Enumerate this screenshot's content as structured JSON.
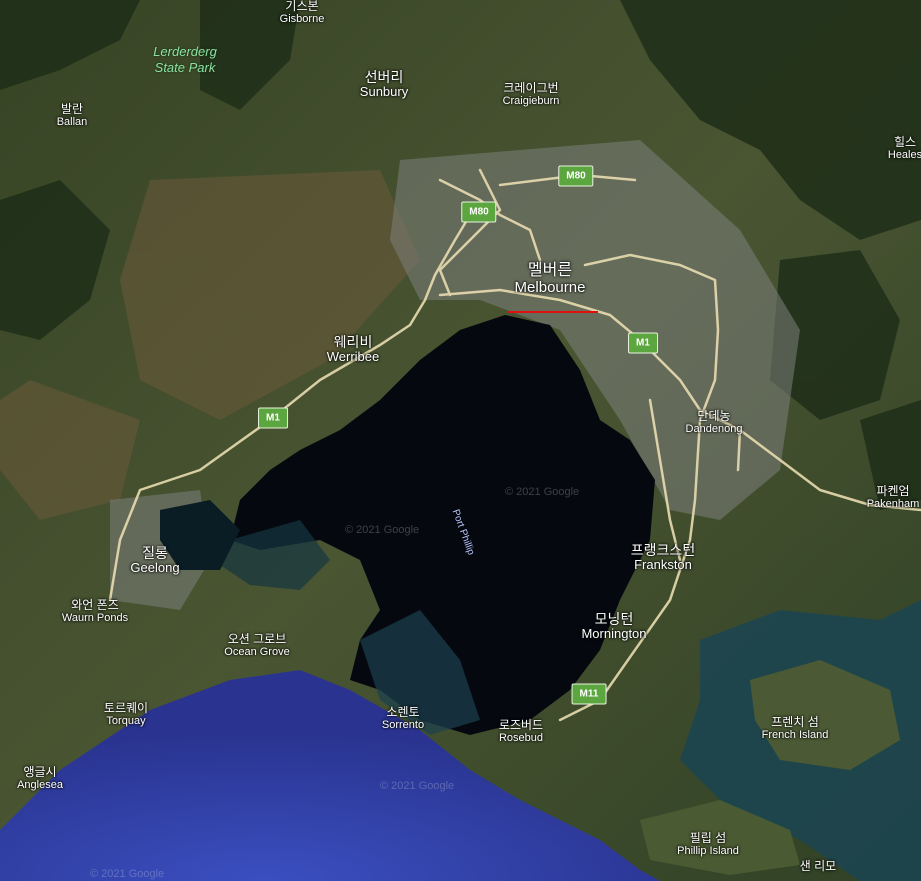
{
  "places": {
    "gisborne": {
      "ko": "기스본",
      "en": "Gisborne"
    },
    "sunbury": {
      "ko": "선버리",
      "en": "Sunbury"
    },
    "craigieburn": {
      "ko": "크레이그번",
      "en": "Craigieburn"
    },
    "bacchus": {
      "ko": "발란",
      "en": "Ballan"
    },
    "healesville": {
      "ko": "힐스",
      "en": "Heales"
    },
    "melbourne": {
      "ko": "멜버른",
      "en": "Melbourne"
    },
    "werribee": {
      "ko": "웨리비",
      "en": "Werribee"
    },
    "dandenong": {
      "ko": "단데농",
      "en": "Dandenong"
    },
    "pakenham": {
      "ko": "파켄엄",
      "en": "Pakenham"
    },
    "geelong": {
      "ko": "질롱",
      "en": "Geelong"
    },
    "frankston": {
      "ko": "프랭크스턴",
      "en": "Frankston"
    },
    "waurn": {
      "ko": "와언 폰즈",
      "en": "Waurn Ponds"
    },
    "mornington": {
      "ko": "모닝턴",
      "en": "Mornington"
    },
    "oceangrove": {
      "ko": "오션 그로브",
      "en": "Ocean Grove"
    },
    "torquay": {
      "ko": "토르퀘이",
      "en": "Torquay"
    },
    "sorrento": {
      "ko": "소렌토",
      "en": "Sorrento"
    },
    "rosebud": {
      "ko": "로즈버드",
      "en": "Rosebud"
    },
    "frenchisland": {
      "ko": "프렌치 섬",
      "en": "French Island"
    },
    "anglesea": {
      "ko": "앵글시",
      "en": "Anglesea"
    },
    "phillipisland": {
      "ko": "필립 섬",
      "en": "Phillip Island"
    },
    "sanremo": {
      "ko": "샌 리모",
      "en": ""
    }
  },
  "park": {
    "line1": "Lerderderg",
    "line2": "State Park"
  },
  "water": {
    "port_phillip": "Port Phillip"
  },
  "shields": {
    "m80a": "M80",
    "m80b": "M80",
    "m1a": "M1",
    "m1b": "M1",
    "m11": "M11"
  },
  "copyright": {
    "a": "© 2021 Google",
    "b": "© 2021 Google",
    "c": "© 2021 Google",
    "d": "© 2021 Google"
  },
  "colors": {
    "land": "#3e4a2a",
    "bay": "#05090f",
    "ocean": "#2d3ea0",
    "road": "#e8dcb0",
    "highway_shield": "#5ba63f",
    "highlight_line": "#e01010"
  }
}
